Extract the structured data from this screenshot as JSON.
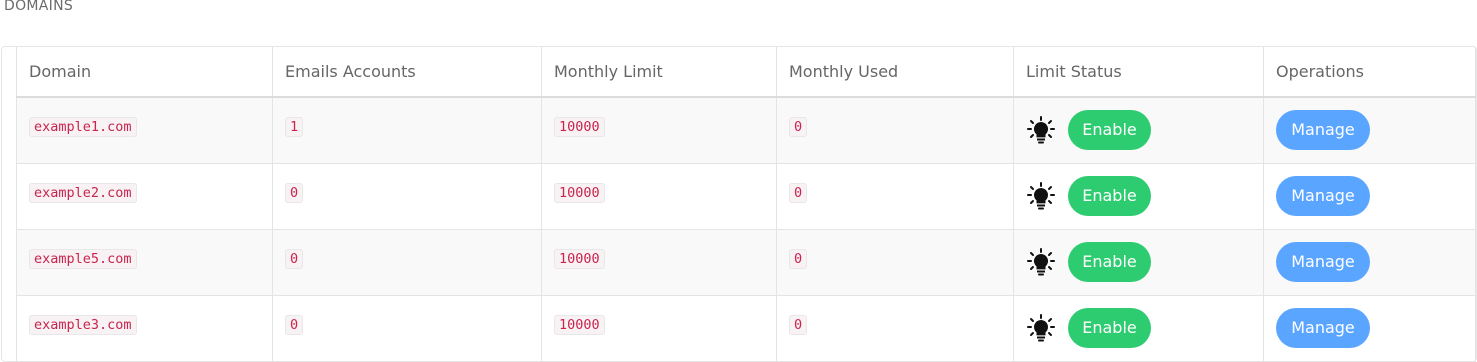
{
  "page": {
    "title": "DOMAINS"
  },
  "table": {
    "columns": [
      "Domain",
      "Emails Accounts",
      "Monthly Limit",
      "Monthly Used",
      "Limit Status",
      "Operations"
    ],
    "rows": [
      {
        "domain": "example1.com",
        "emails": "1",
        "limit": "10000",
        "used": "0",
        "status_label": "Enable",
        "action_label": "Manage"
      },
      {
        "domain": "example2.com",
        "emails": "0",
        "limit": "10000",
        "used": "0",
        "status_label": "Enable",
        "action_label": "Manage"
      },
      {
        "domain": "example5.com",
        "emails": "0",
        "limit": "10000",
        "used": "0",
        "status_label": "Enable",
        "action_label": "Manage"
      },
      {
        "domain": "example3.com",
        "emails": "0",
        "limit": "10000",
        "used": "0",
        "status_label": "Enable",
        "action_label": "Manage"
      }
    ]
  },
  "colors": {
    "enable_button": "#2ecc71",
    "manage_button": "#5aa5ff",
    "code_text": "#c7254e"
  },
  "icons": {
    "status_icon": "lightbulb-icon"
  }
}
